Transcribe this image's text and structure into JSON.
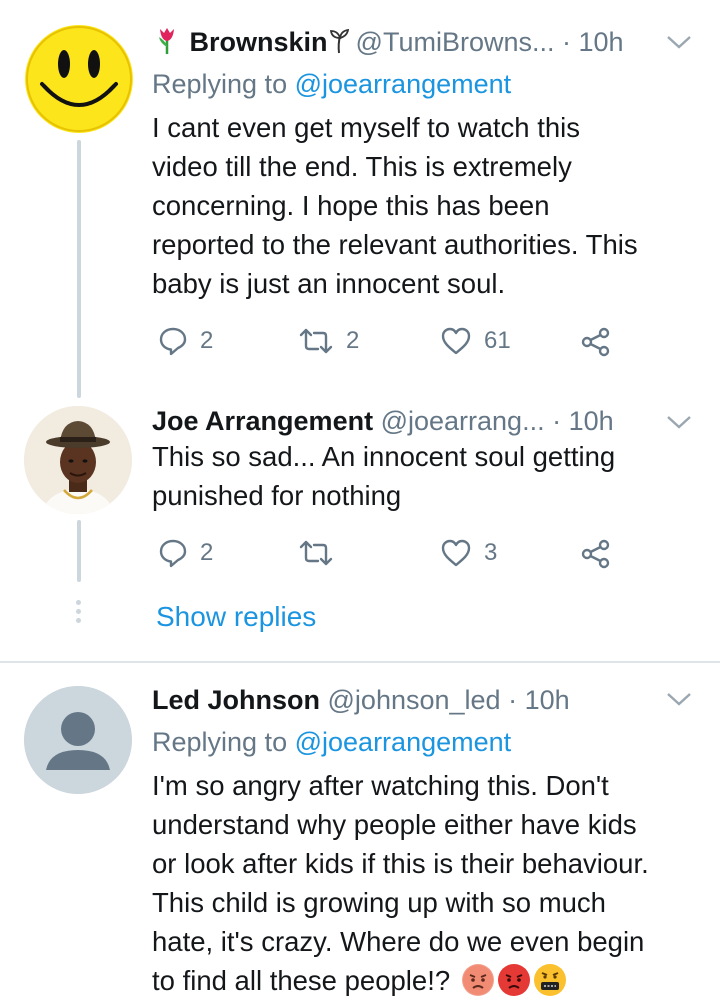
{
  "tweets": [
    {
      "name": "Brownskin",
      "name_prefix_icon": "tulip-icon",
      "name_suffix_icon": "herb-icon",
      "handle": "@TumiBrowns...",
      "time": "· 10h",
      "replying_label": "Replying to",
      "replying_to": "@joearrangement",
      "text_lines": [
        "I cant even get myself to watch this",
        "video till the end. This is extremely",
        "concerning. I hope this has been",
        "reported to the relevant authorities. This",
        "baby is just an innocent soul."
      ],
      "replies": "2",
      "retweets": "2",
      "likes": "61"
    },
    {
      "name": "Joe Arrangement",
      "handle": "@joearrang...",
      "time": "· 10h",
      "text_lines": [
        "This so sad... An innocent soul getting",
        "punished for nothing"
      ],
      "replies": "2",
      "retweets": "",
      "likes": "3",
      "show_replies": "Show replies"
    },
    {
      "name": "Led Johnson",
      "handle": "@johnson_led",
      "time": "· 10h",
      "replying_label": "Replying to",
      "replying_to": "@joearrangement",
      "text_lines": [
        "I'm so angry after watching this. Don't",
        "understand why people either have kids",
        "or look after kids if this is their behaviour.",
        "This child is growing up with so much",
        "hate, it's crazy. Where do we even begin",
        "to find all these people!?"
      ],
      "emojis": [
        "angry-face-icon",
        "pouting-face-icon",
        "cursing-face-icon"
      ]
    }
  ],
  "colors": {
    "text": "#14171a",
    "secondary": "#657786",
    "link": "#1b95e0",
    "thread_line": "#cdd6dd",
    "divider": "#dfe4e8"
  }
}
